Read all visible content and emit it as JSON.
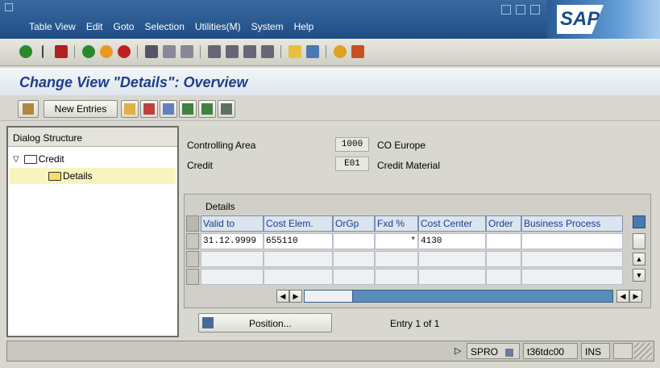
{
  "menu": {
    "items": [
      "Table View",
      "Edit",
      "Goto",
      "Selection",
      "Utilities(M)",
      "System",
      "Help"
    ]
  },
  "logo": {
    "text": "SAP"
  },
  "page": {
    "title": "Change View \"Details\": Overview"
  },
  "app_toolbar": {
    "new_entries_label": "New Entries"
  },
  "dialog_structure": {
    "header": "Dialog Structure",
    "items": [
      {
        "label": "Credit"
      },
      {
        "label": "Details"
      }
    ]
  },
  "header_fields": {
    "controlling_area": {
      "label": "Controlling Area",
      "value": "1000",
      "description": "CO Europe"
    },
    "credit": {
      "label": "Credit",
      "value": "E01",
      "description": "Credit Material"
    }
  },
  "table": {
    "title": "Details",
    "columns": [
      "Valid to",
      "Cost Elem.",
      "OrGp",
      "Fxd %",
      "Cost Center",
      "Order",
      "Business Process"
    ],
    "rows": [
      [
        "31.12.9999",
        "655110",
        "",
        "*",
        "4130",
        "",
        ""
      ],
      [
        "",
        "",
        "",
        "",
        "",
        "",
        ""
      ],
      [
        "",
        "",
        "",
        "",
        "",
        "",
        ""
      ]
    ]
  },
  "position_button": {
    "label": "Position..."
  },
  "entry_info": "Entry 1 of 1",
  "status_bar": {
    "transaction": "SPRO",
    "server": "t36tdc00",
    "mode": "INS"
  },
  "colors": {
    "menubar": "#1f4d86",
    "title_text": "#1b3f8a",
    "tree_highlight": "#f8f4c0",
    "header_blue": "#dce4f0"
  }
}
